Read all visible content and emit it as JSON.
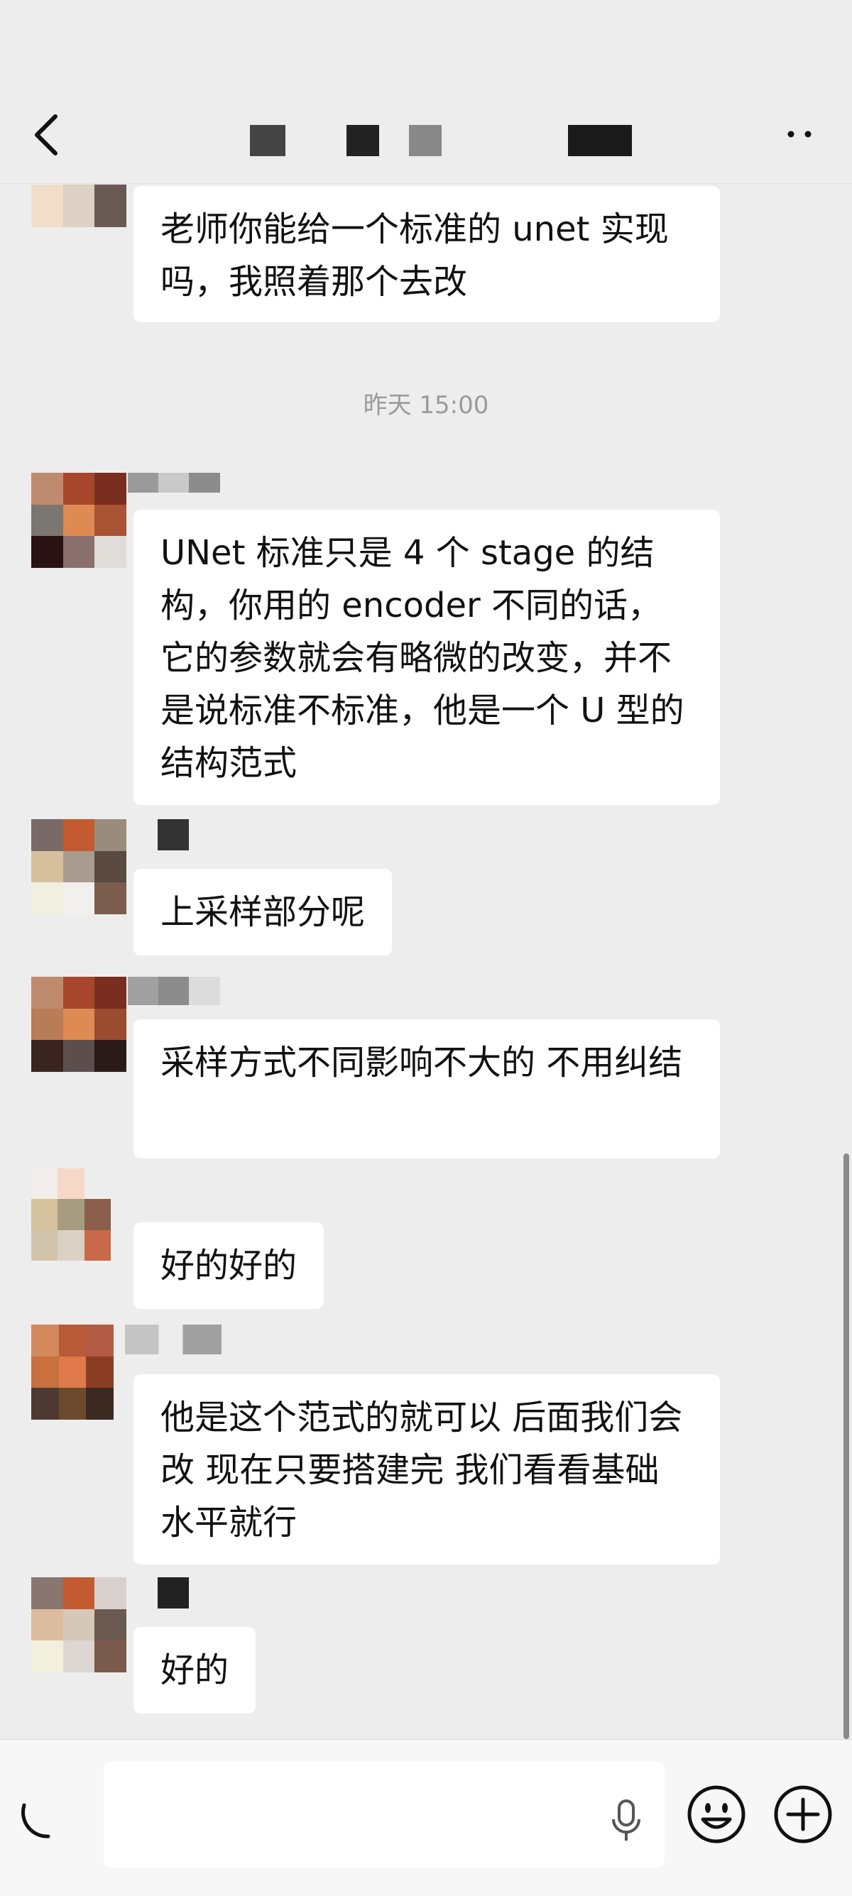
{
  "header": {
    "title_redacted": true
  },
  "timestamp": "昨天 15:00",
  "messages": [
    {
      "id": "m0",
      "text": "老师你能给一个标准的 unet 实现吗，我照着那个去改"
    },
    {
      "id": "m1",
      "text": "UNet 标准只是 4 个 stage 的结构，你用的 encoder 不同的话，它的参数就会有略微的改变，并不是说标准不标准，他是一个 U 型的结构范式"
    },
    {
      "id": "m2",
      "text": "上采样部分呢"
    },
    {
      "id": "m3",
      "text": "采样方式不同影响不大的 不用纠结"
    },
    {
      "id": "m4",
      "text": "好的好的"
    },
    {
      "id": "m5",
      "text": "他是这个范式的就可以 后面我们会改 现在只要搭建完 我们看看基础水平就行"
    },
    {
      "id": "m6",
      "text": "好的"
    }
  ],
  "input": {
    "value": "",
    "placeholder": ""
  },
  "icons": {
    "back": "chevron-left-icon",
    "more": "more-icon",
    "voice": "voice-icon",
    "mic": "mic-icon",
    "emoji": "emoji-icon",
    "plus": "plus-icon"
  },
  "colors": {
    "background": "#ededed",
    "bubble": "#ffffff",
    "timestamp": "#9a9a9a"
  }
}
